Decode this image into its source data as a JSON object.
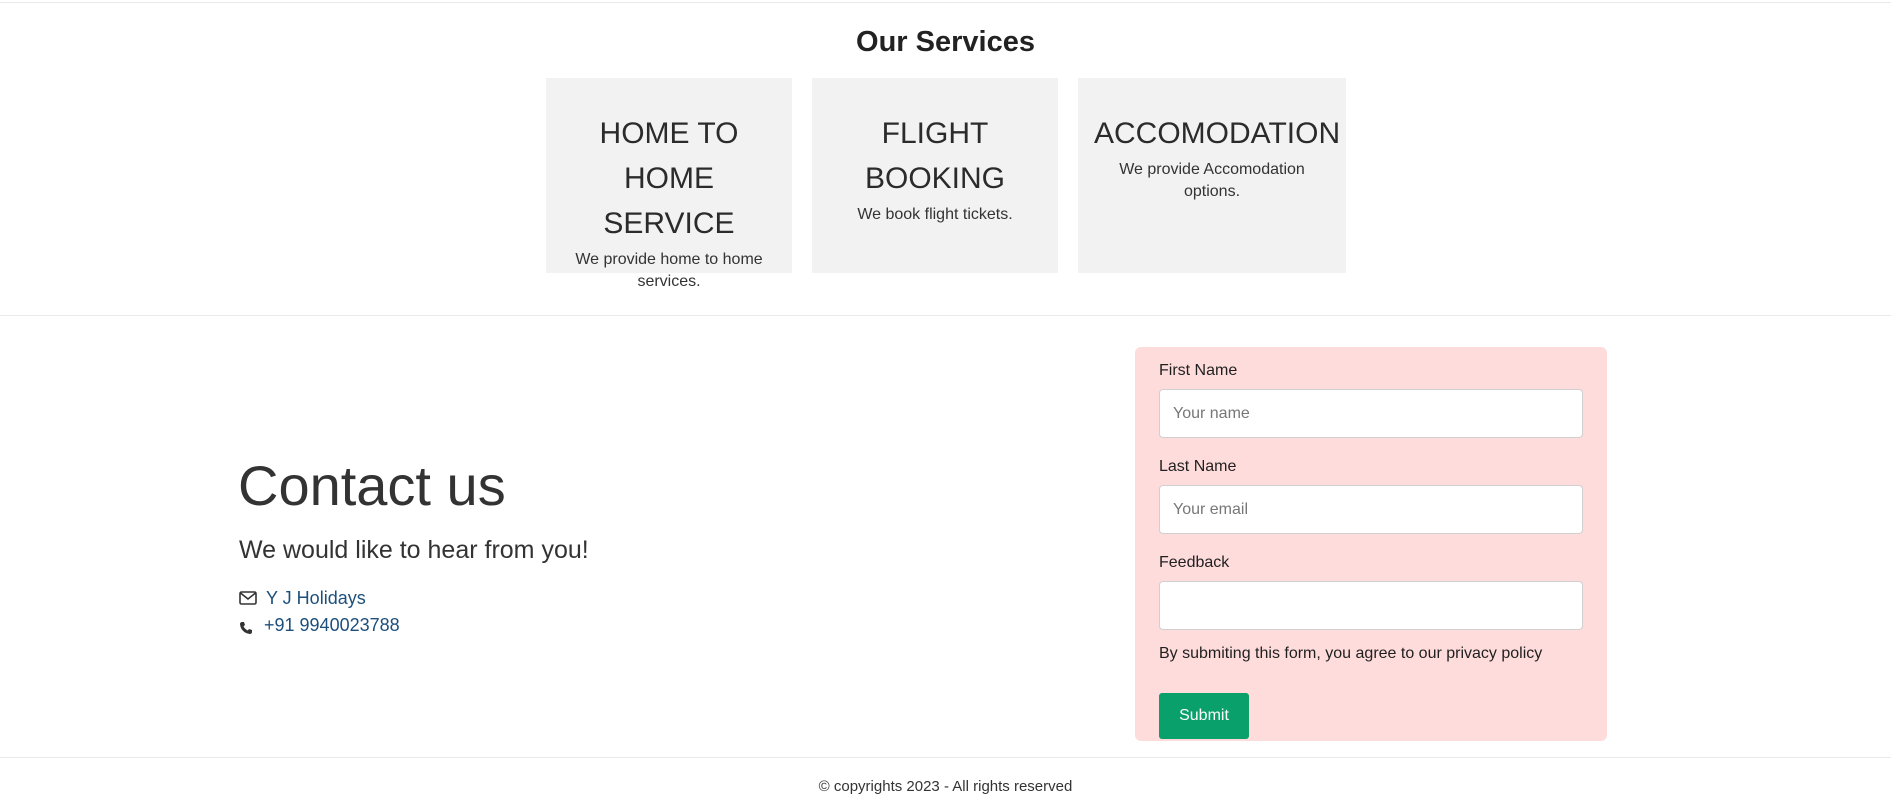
{
  "services": {
    "title": "Our Services",
    "cards": [
      {
        "title_line1": "HOME TO",
        "title_line2": "HOME SERVICE",
        "description": "We provide home to home services."
      },
      {
        "title_line1": "FLIGHT",
        "title_line2": "BOOKING",
        "description": "We book flight tickets."
      },
      {
        "title_line1": "ACCOMODATION",
        "title_line2": "",
        "description": "We provide Accomodation options."
      }
    ]
  },
  "contact": {
    "heading": "Contact us",
    "subheading": "We would like to hear from you!",
    "email_link": "Y J Holidays",
    "phone_link": "+91 9940023788",
    "email_icon": "envelope-icon",
    "phone_icon": "phone-icon",
    "link_color": "#1c4f7c"
  },
  "form": {
    "background": "#ffdcdc",
    "first_name_label": "First Name",
    "first_name_placeholder": "Your name",
    "first_name_value": "",
    "last_name_label": "Last Name",
    "last_name_placeholder": "Your email",
    "last_name_value": "",
    "feedback_label": "Feedback",
    "feedback_value": "",
    "privacy_text": "By submiting this form, you agree to our privacy policy",
    "submit_label": "Submit",
    "submit_color": "#0aa06b"
  },
  "footer": {
    "copyright": "© copyrights 2023 - All rights reserved"
  }
}
